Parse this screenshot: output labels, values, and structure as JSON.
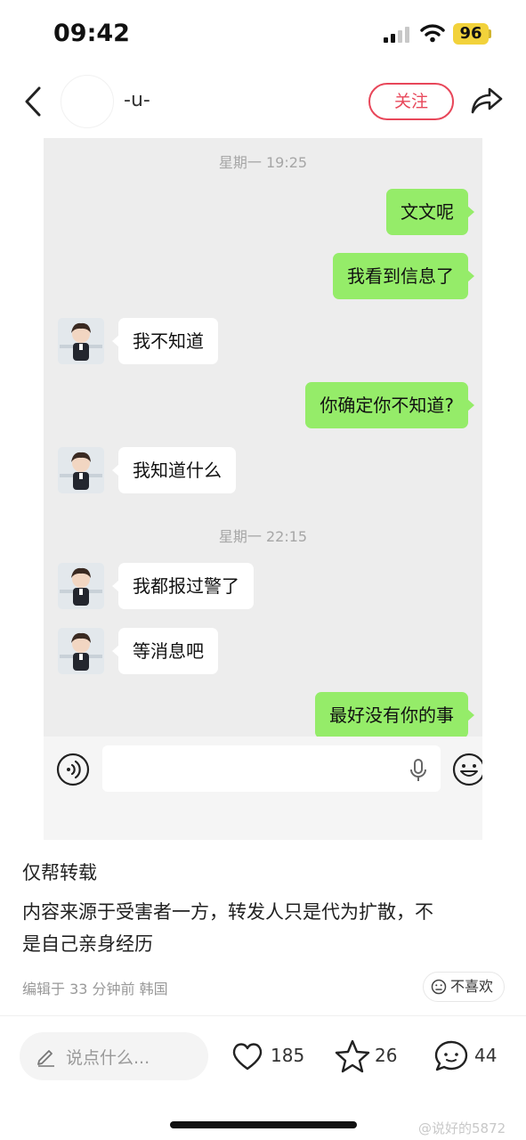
{
  "status_bar": {
    "time": "09:42",
    "battery": "96"
  },
  "nav": {
    "username": "-u-",
    "follow_label": "关注"
  },
  "chat": {
    "timestamps": [
      "星期一 19:25",
      "星期一 22:15"
    ],
    "messages": [
      {
        "side": "sent",
        "text": "文文呢"
      },
      {
        "side": "sent",
        "text": "我看到信息了"
      },
      {
        "side": "recv",
        "text": "我不知道"
      },
      {
        "side": "sent",
        "text": "你确定你不知道?"
      },
      {
        "side": "recv",
        "text": "我知道什么"
      },
      {
        "side": "recv",
        "text": "我都报过警了"
      },
      {
        "side": "recv",
        "text": "等消息吧"
      },
      {
        "side": "sent",
        "text": "最好没有你的事"
      }
    ]
  },
  "post": {
    "lines": [
      "仅帮转载",
      "内容来源于受害者一方，转发人只是代为扩散，不",
      "是自己亲身经历"
    ],
    "meta": "编辑于 33 分钟前 韩国",
    "dislike_label": "不喜欢"
  },
  "bottom_bar": {
    "comment_placeholder": "说点什么...",
    "likes": "185",
    "favorites": "26",
    "comments": "44"
  },
  "watermark": "@说好的5872",
  "colors": {
    "accent": "#e8475a",
    "sent_bubble": "#95ec69",
    "chat_bg": "#ededed"
  },
  "icons": [
    "back-icon",
    "share-icon",
    "voice-icon",
    "microphone-icon",
    "emoji-icon",
    "pencil-icon",
    "heart-icon",
    "star-icon",
    "comment-icon",
    "dislike-face-icon"
  ]
}
